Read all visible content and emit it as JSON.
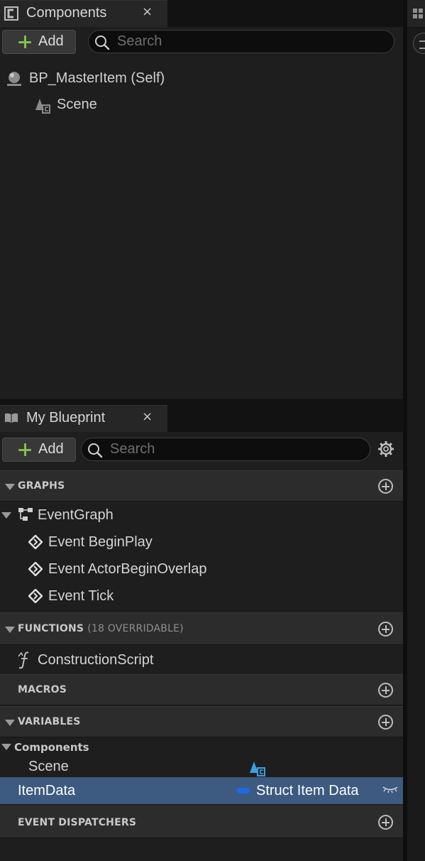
{
  "components_panel": {
    "tab_title": "Components",
    "close_glyph": "×",
    "add_label": "Add",
    "search_placeholder": "Search",
    "tree": [
      {
        "label": "BP_MasterItem (Self)",
        "icon": "actor-sphere-icon"
      },
      {
        "label": "Scene",
        "icon": "scene-component-icon"
      }
    ]
  },
  "my_blueprint_panel": {
    "tab_title": "My Blueprint",
    "close_glyph": "×",
    "add_label": "Add",
    "search_placeholder": "Search",
    "sections": {
      "graphs": {
        "title": "GRAPHS",
        "event_graph": "EventGraph",
        "events": [
          "Event BeginPlay",
          "Event ActorBeginOverlap",
          "Event Tick"
        ]
      },
      "functions": {
        "title": "FUNCTIONS",
        "subtitle": "(18 OVERRIDABLE)",
        "items": [
          "ConstructionScript"
        ]
      },
      "macros": {
        "title": "MACROS"
      },
      "variables": {
        "title": "VARIABLES",
        "category": "Components",
        "component_var": "Scene",
        "selected_var": {
          "name": "ItemData",
          "type": "Struct Item Data",
          "type_color": "#1d6ae3"
        }
      },
      "event_dispatchers": {
        "title": "EVENT DISPATCHERS"
      }
    }
  },
  "colors": {
    "add_plus": "#7fc249",
    "selection": "#3d5a80",
    "scene_icon": "#3aa0e0"
  }
}
